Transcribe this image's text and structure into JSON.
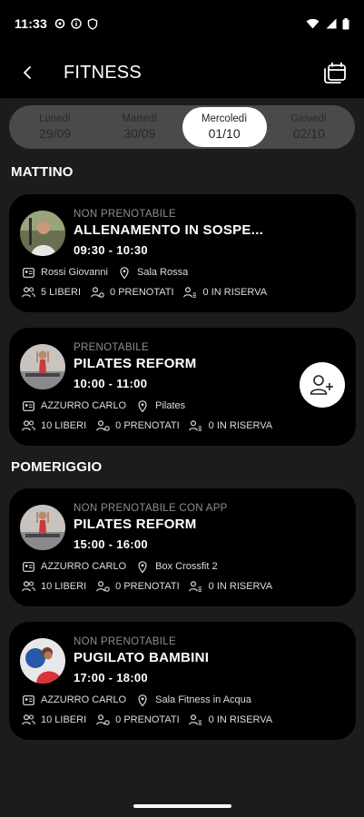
{
  "status_bar": {
    "time": "11:33"
  },
  "header": {
    "title": "FITNESS"
  },
  "days": [
    {
      "name": "Lunedì",
      "date": "29/09"
    },
    {
      "name": "Martedì",
      "date": "30/09"
    },
    {
      "name": "Mercoledì",
      "date": "01/10"
    },
    {
      "name": "Giovedì",
      "date": "02/10"
    }
  ],
  "sections": {
    "morning": "MATTINO",
    "afternoon": "POMERIGGIO"
  },
  "classes": [
    {
      "status": "NON PRENOTABILE",
      "name": "ALLENAMENTO IN SOSPE...",
      "time": "09:30 - 10:30",
      "instructor": "Rossi Giovanni",
      "room": "Sala Rossa",
      "free": "5 LIBERI",
      "booked": "0 PRENOTATI",
      "reserve": "0 IN RISERVA"
    },
    {
      "status": "PRENOTABILE",
      "name": "PILATES REFORM",
      "time": "10:00 - 11:00",
      "instructor": "AZZURRO CARLO",
      "room": "Pilates",
      "free": "10 LIBERI",
      "booked": "0 PRENOTATI",
      "reserve": "0 IN RISERVA"
    },
    {
      "status": "NON PRENOTABILE CON APP",
      "name": "PILATES REFORM",
      "time": "15:00 - 16:00",
      "instructor": "AZZURRO CARLO",
      "room": "Box Crossfit 2",
      "free": "10 LIBERI",
      "booked": "0 PRENOTATI",
      "reserve": "0 IN RISERVA"
    },
    {
      "status": "NON PRENOTABILE",
      "name": "PUGILATO BAMBINI",
      "time": "17:00 - 18:00",
      "instructor": "AZZURRO CARLO",
      "room": "Sala Fitness in Acqua",
      "free": "10 LIBERI",
      "booked": "0 PRENOTATI",
      "reserve": "0 IN RISERVA"
    }
  ]
}
